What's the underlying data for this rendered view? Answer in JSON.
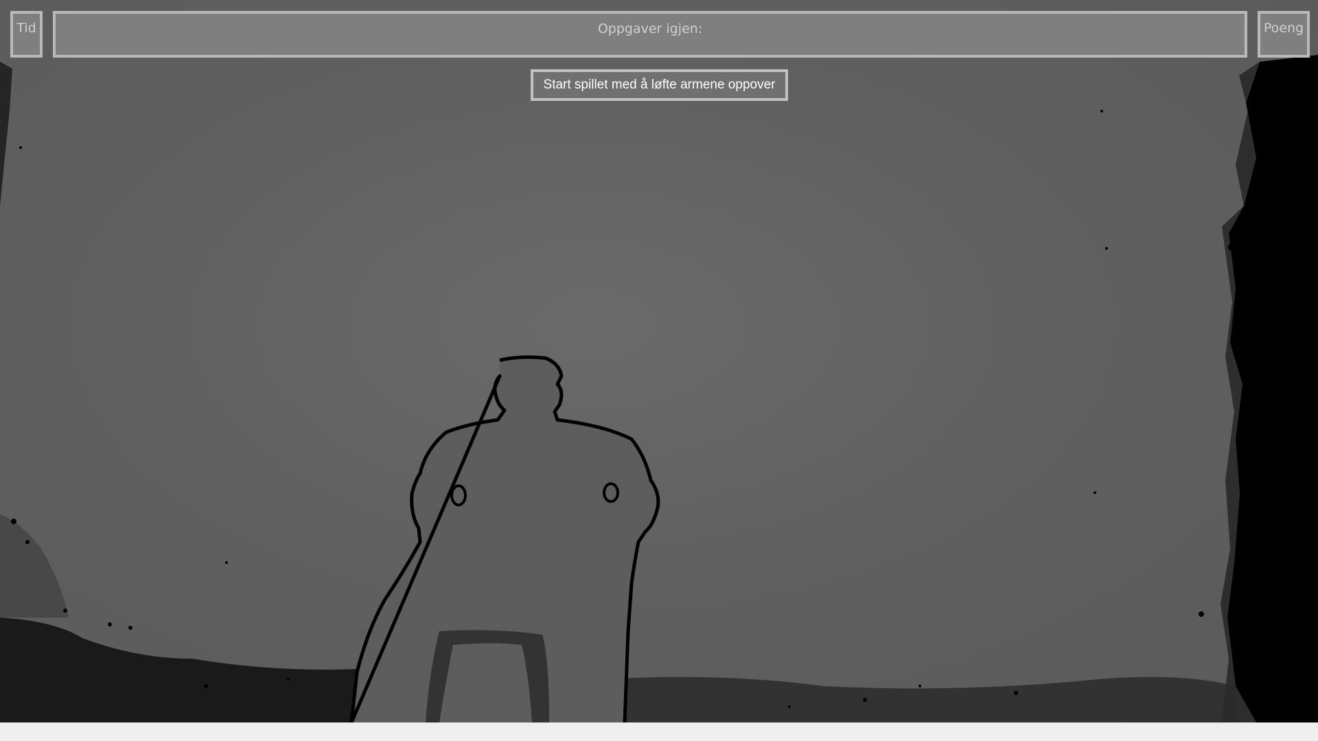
{
  "hud": {
    "time_label": "Tid",
    "tasks_label": "Oppgaver igjen:",
    "score_label": "Poeng"
  },
  "start_button": {
    "label": "Start spillet med å løfte armene oppover"
  },
  "colors": {
    "hud_box_fill": "#7f7f7f",
    "hud_box_border": "#b9b9b9",
    "hud_text": "#d0d0d0",
    "button_text": "#ffffff",
    "depth_background": "#606060",
    "depth_shadow": "#000000"
  }
}
